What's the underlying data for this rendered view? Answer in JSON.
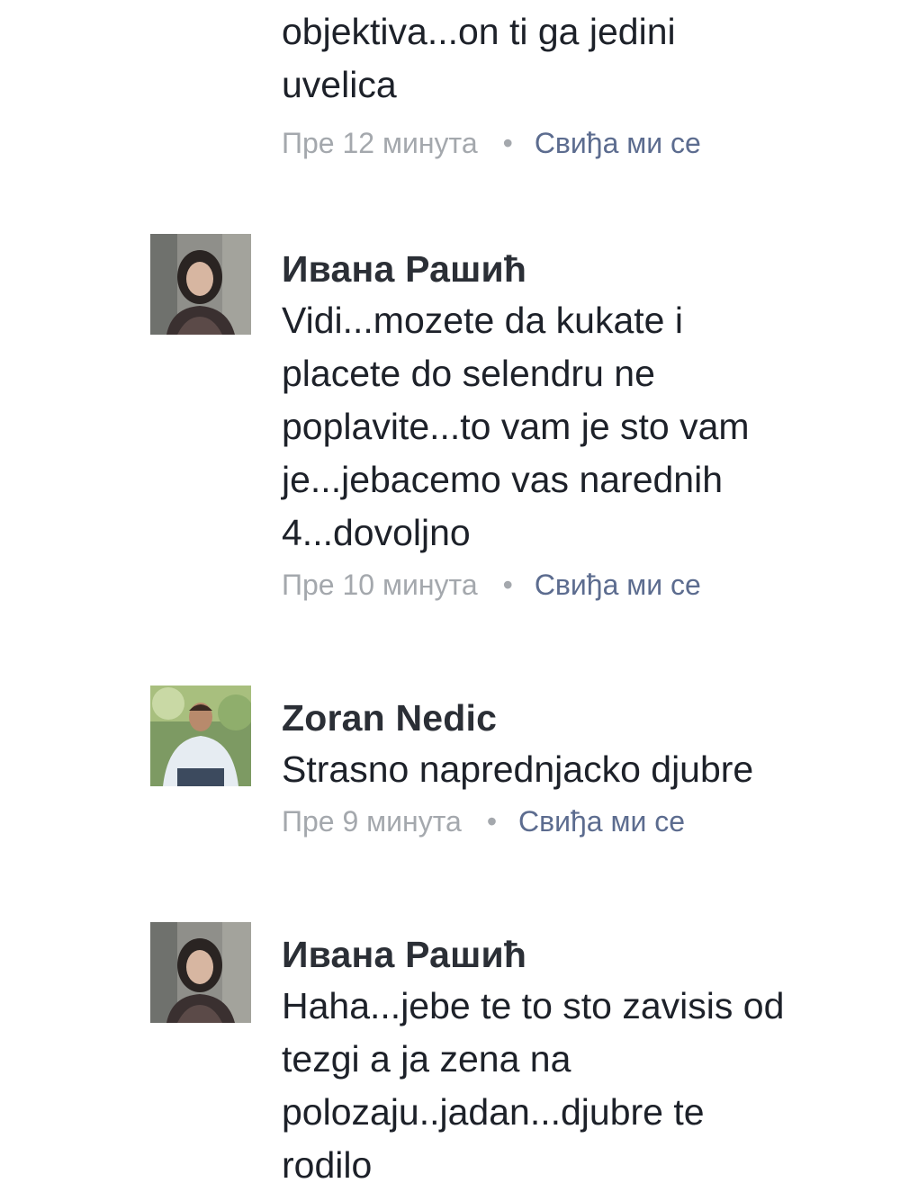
{
  "comments": [
    {
      "author": "",
      "text": "objektiva...on ti ga jedini\nuvelica",
      "time": "Пре 12 минута",
      "separator": "•",
      "like": "Свиђа ми се"
    },
    {
      "author": "Ивана Рашић",
      "text": "Vidi...mozete da kukate i\nplacete do selendru ne\npoplavite...to vam je sto vam\nje...jebacemo vas narednih\n4...dovoljno",
      "time": "Пре 10 минута",
      "separator": "•",
      "like": "Свиђа ми се"
    },
    {
      "author": "Zoran Nedic",
      "text": "Strasno naprednjacko djubre",
      "time": "Пре 9 минута",
      "separator": "•",
      "like": "Свиђа ми се"
    },
    {
      "author": "Ивана Рашић",
      "text": "Haha...jebe te to sto zavisis od\ntezgi a ja zena na\npolozaju..jadan...djubre te\nrodilo",
      "time": "",
      "separator": "",
      "like": ""
    }
  ],
  "colors": {
    "like_link": "#5c6c8f",
    "meta_gray": "#a4a8ad",
    "author": "#2b2f36",
    "text": "#1d2129"
  }
}
